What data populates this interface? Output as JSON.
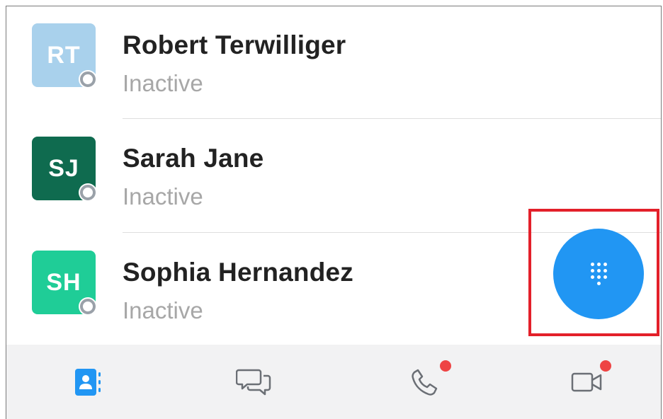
{
  "contacts": [
    {
      "initials": "RT",
      "name": "Robert Terwilliger",
      "status": "Inactive",
      "avatar_color": "#a9d1ec"
    },
    {
      "initials": "SJ",
      "name": "Sarah Jane",
      "status": "Inactive",
      "avatar_color": "#0f6b4f"
    },
    {
      "initials": "SH",
      "name": "Sophia Hernandez",
      "status": "Inactive",
      "avatar_color": "#1fcd97"
    }
  ],
  "tabs": [
    {
      "icon": "contacts-icon",
      "active": true,
      "badge": false
    },
    {
      "icon": "chat-icon",
      "active": false,
      "badge": false
    },
    {
      "icon": "phone-icon",
      "active": false,
      "badge": true
    },
    {
      "icon": "video-icon",
      "active": false,
      "badge": true
    }
  ],
  "colors": {
    "accent": "#2196f3",
    "badge": "#ee4444",
    "highlight": "#e3202a",
    "inactive_text": "#a7a7a7",
    "tabbar_bg": "#f2f2f3"
  },
  "fab": {
    "icon": "dialpad-icon"
  }
}
